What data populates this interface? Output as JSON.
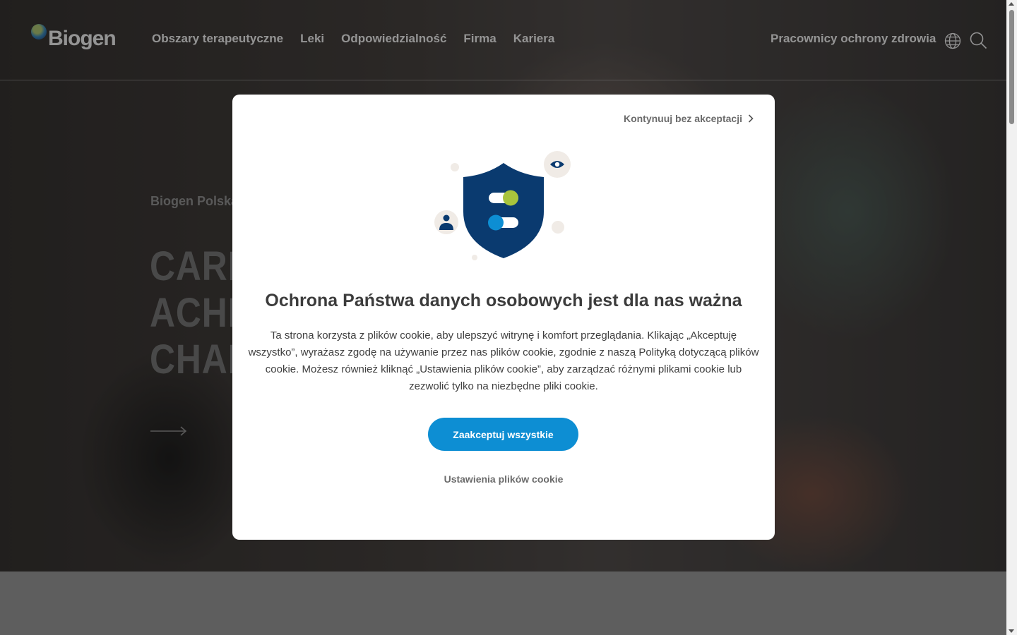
{
  "header": {
    "brand": "Biogen",
    "nav": [
      "Obszary terapeutyczne",
      "Leki",
      "Odpowiedzialność",
      "Firma",
      "Kariera"
    ],
    "hcp_link": "Pracownicy ochrony zdrowia",
    "icons": {
      "language": "globe-icon",
      "search": "search-icon"
    }
  },
  "hero": {
    "eyebrow": "Biogen Polska",
    "title_lines": [
      "CARI",
      "ACHI",
      "CHAI"
    ],
    "arrow_icon": "arrow-right-icon"
  },
  "cookie_modal": {
    "skip_label": "Kontynuuj bez akceptacji",
    "title": "Ochrona Państwa danych osobowych jest dla nas ważna",
    "body": "Ta strona korzysta z plików cookie, aby ulepszyć witrynę i komfort przeglądania. Klikając „Akceptuję wszystko”, wyrażasz zgodę na używanie przez nas plików cookie, zgodnie z naszą Polityką dotyczącą plików cookie. Możesz również kliknąć „Ustawienia plików cookie”, aby zarządzać różnymi plikami cookie lub zezwolić tylko na niezbędne pliki cookie.",
    "accept_label": "Zaakceptuj wszystkie",
    "settings_label": "Ustawienia plików cookie",
    "colors": {
      "accent": "#0d8ed3",
      "shield": "#0a3a6f",
      "lime": "#a8c43c"
    }
  }
}
